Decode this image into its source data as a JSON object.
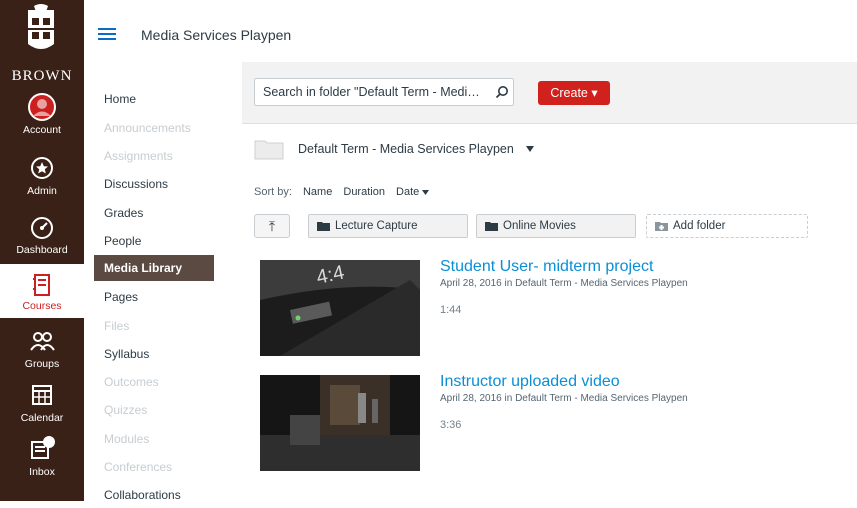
{
  "brand": {
    "name": "BROWN"
  },
  "global_nav": [
    {
      "label": "Account",
      "icon": "account-icon"
    },
    {
      "label": "Admin",
      "icon": "admin-shield-icon"
    },
    {
      "label": "Dashboard",
      "icon": "dashboard-icon"
    },
    {
      "label": "Courses",
      "icon": "courses-icon",
      "active": true
    },
    {
      "label": "Groups",
      "icon": "groups-icon"
    },
    {
      "label": "Calendar",
      "icon": "calendar-icon"
    },
    {
      "label": "Inbox",
      "icon": "inbox-icon"
    }
  ],
  "header": {
    "context_title": "Media Services Playpen"
  },
  "course_nav": [
    {
      "label": "Home",
      "state": "normal"
    },
    {
      "label": "Announcements",
      "state": "disabled"
    },
    {
      "label": "Assignments",
      "state": "disabled"
    },
    {
      "label": "Discussions",
      "state": "normal"
    },
    {
      "label": "Grades",
      "state": "normal"
    },
    {
      "label": "People",
      "state": "normal"
    },
    {
      "label": "Media Library",
      "state": "active"
    },
    {
      "label": "Pages",
      "state": "normal"
    },
    {
      "label": "Files",
      "state": "disabled"
    },
    {
      "label": "Syllabus",
      "state": "normal"
    },
    {
      "label": "Outcomes",
      "state": "disabled"
    },
    {
      "label": "Quizzes",
      "state": "disabled"
    },
    {
      "label": "Modules",
      "state": "disabled"
    },
    {
      "label": "Conferences",
      "state": "disabled"
    },
    {
      "label": "Collaborations",
      "state": "normal"
    }
  ],
  "search": {
    "value": "Search in folder \"Default Term - Medi…"
  },
  "create_button": {
    "label": "Create ▾"
  },
  "folder": {
    "title": "Default Term - Media Services Playpen"
  },
  "sort": {
    "label": "Sort by:",
    "options": [
      "Name",
      "Duration",
      "Date"
    ]
  },
  "subfolders": {
    "up_label": "⤒",
    "items": [
      "Lecture Capture",
      "Online Movies"
    ],
    "add_label": "Add folder"
  },
  "media": [
    {
      "title": "Student User- midterm project",
      "date": "April 28, 2016",
      "in_word": " in ",
      "folder": "Default Term - Media Services Playpen",
      "duration": "1:44"
    },
    {
      "title": "Instructor uploaded video",
      "date": "April 28, 2016",
      "in_word": " in ",
      "folder": "Default Term - Media Services Playpen",
      "duration": "3:36"
    }
  ],
  "colors": {
    "nav_bg": "#3a2118",
    "accent_red": "#d0211c",
    "link_blue": "#0a8fd6",
    "active_course_nav": "#5a4a42"
  }
}
